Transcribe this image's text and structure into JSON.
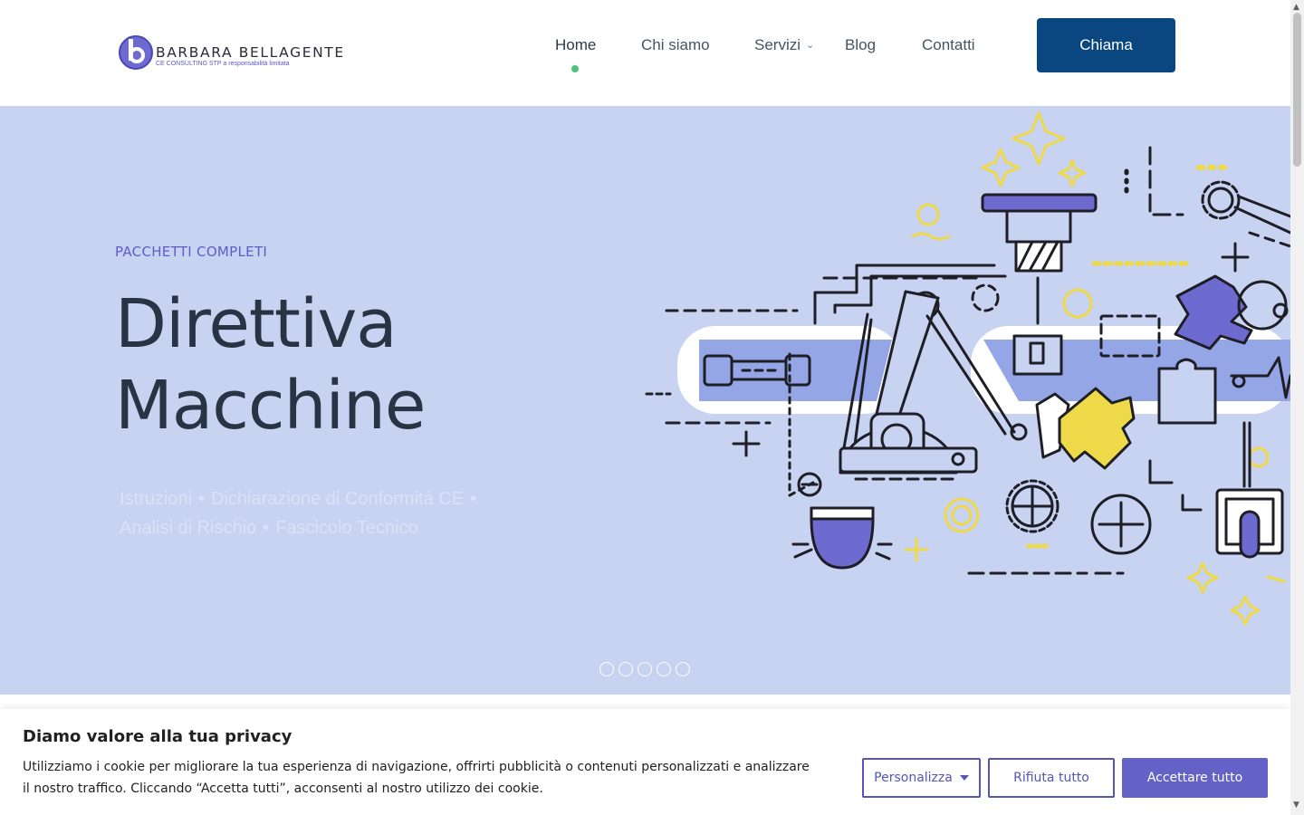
{
  "header": {
    "logo": {
      "name": "BARBARA BELLAGENTE",
      "subtitle": "CE CONSULTING STP a responsabilità limitata"
    },
    "nav": [
      {
        "label": "Home",
        "active": true
      },
      {
        "label": "Chi siamo",
        "active": false
      },
      {
        "label": "Servizi",
        "active": false,
        "has_dropdown": true
      },
      {
        "label": "Blog",
        "active": false
      },
      {
        "label": "Contatti",
        "active": false
      }
    ],
    "cta_label": "Chiama"
  },
  "hero": {
    "eyebrow": "PACCHETTI COMPLETI",
    "title_line1": "Direttiva",
    "title_line2": "Macchine",
    "items": [
      "Istruzioni",
      "Dichiarazione di Conformità CE",
      "Analisi di Rischio",
      "Fascicolo Tecnico"
    ],
    "separator": "•",
    "slide_count": 5,
    "active_slide": 1
  },
  "cookie_banner": {
    "title": "Diamo valore alla tua privacy",
    "text": "Utilizziamo i cookie per migliorare la tua esperienza di navigazione, offrirti pubblicità o contenuti personalizzati e analizzare il nostro traffico. Cliccando “Accetta tutti”, acconsenti al nostro utilizzo dei cookie.",
    "customize_label": "Personalizza",
    "reject_label": "Rifiuta tutto",
    "accept_label": "Accettare tutto"
  },
  "colors": {
    "hero_bg": "#c8d2f1",
    "accent_purple": "#6462c6",
    "nav_button": "#0a4680",
    "active_dot": "#4cc37f",
    "illustration_yellow": "#eed948",
    "illustration_blue": "#95a6e6"
  }
}
